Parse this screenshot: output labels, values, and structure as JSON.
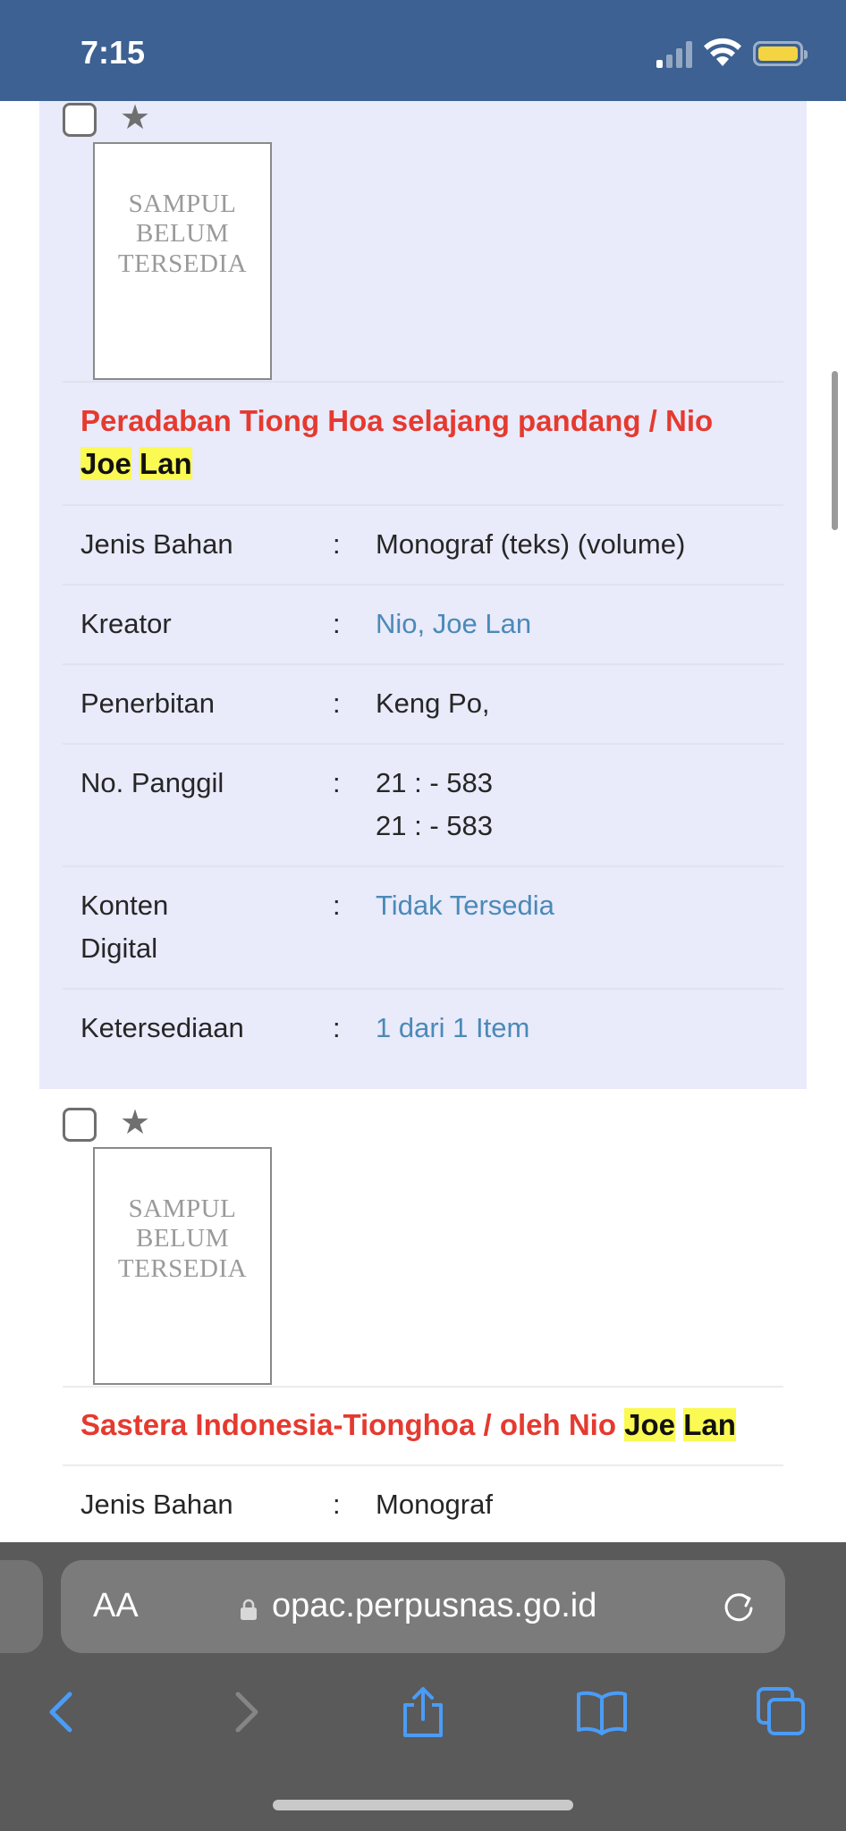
{
  "status_bar": {
    "time": "7:15",
    "battery_color": "#f5d442",
    "signal": "1 of 4 bars"
  },
  "records": [
    {
      "cover_text": "SAMPUL BELUM TERSEDIA",
      "title_main": "Peradaban Tiong Hoa selajang pandang / Nio",
      "title_hl1": "Joe",
      "title_hl2": "Lan",
      "fields": {
        "jenis_bahan": {
          "label": "Jenis Bahan",
          "value": "Monograf (teks) (volume)"
        },
        "kreator": {
          "label": "Kreator",
          "value": "Nio, Joe Lan"
        },
        "penerbitan": {
          "label": "Penerbitan",
          "value": "Keng Po,"
        },
        "no_panggil": {
          "label": "No. Panggil",
          "value1": "21 : - 583",
          "value2": "21 : - 583"
        },
        "konten_digital": {
          "label1": "Konten",
          "label2": "Digital",
          "value": "Tidak Tersedia"
        },
        "ketersediaan": {
          "label": "Ketersediaan",
          "value": "1 dari 1 Item"
        }
      }
    },
    {
      "cover_text": "SAMPUL BELUM TERSEDIA",
      "title_main": "Sastera Indonesia-Tionghoa / oleh Nio",
      "title_hl1": "Joe",
      "title_hl2": "Lan",
      "fields": {
        "jenis_bahan": {
          "label": "Jenis Bahan",
          "value": "Monograf"
        }
      }
    }
  ],
  "colon": ":",
  "cover_lines": [
    "SAMPUL",
    "BELUM",
    "TERSEDIA"
  ],
  "browser": {
    "text_size_label": "AA",
    "url": "opac.perpusnas.go.id"
  },
  "colors": {
    "title_red": "#e53a2f",
    "link_blue": "#4a8ab8",
    "highlight_yellow": "#fafa52",
    "record_bg": "#e9eafa",
    "status_bar_bg": "#3c6192"
  }
}
